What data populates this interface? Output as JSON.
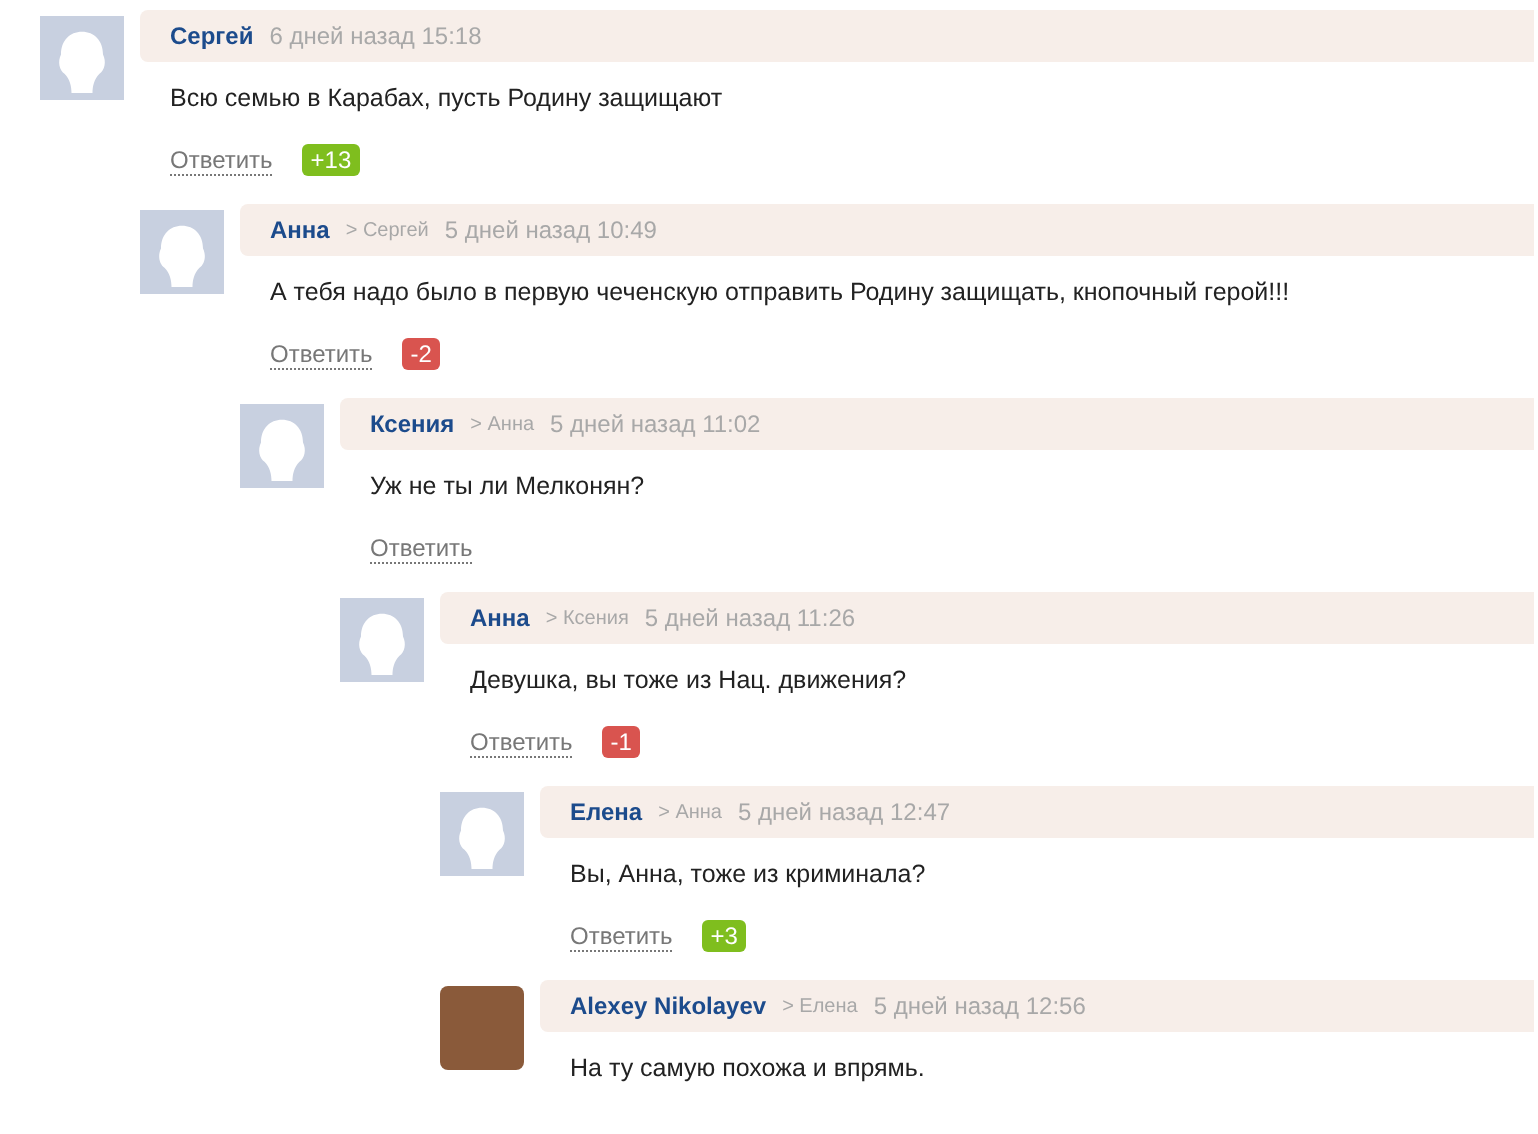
{
  "comments": [
    {
      "author": "Сергей",
      "kind": "silhouette",
      "time": "6 дней назад 15:18",
      "text": "Всю семью в Карабах, пусть Родину защищают",
      "reply": "Ответить",
      "score": {
        "text": "+13",
        "kind": "up"
      },
      "children": [
        {
          "author": "Анна",
          "reply_to": "> Сергей",
          "kind": "silhouette",
          "time": "5 дней назад 10:49",
          "text": "А тебя надо было в первую чеченскую отправить Родину защищать, кнопочный герой!!!",
          "reply": "Ответить",
          "score": {
            "text": "-2",
            "kind": "down"
          },
          "children": [
            {
              "author": "Ксения",
              "reply_to": "> Анна",
              "kind": "silhouette",
              "time": "5 дней назад 11:02",
              "text": "Уж не ты ли Мелконян?",
              "reply": "Ответить",
              "children": [
                {
                  "author": "Анна",
                  "reply_to": "> Ксения",
                  "kind": "silhouette",
                  "time": "5 дней назад 11:26",
                  "text": "Девушка, вы тоже из Нац. движения?",
                  "reply": "Ответить",
                  "score": {
                    "text": "-1",
                    "kind": "down"
                  },
                  "children": [
                    {
                      "author": "Елена",
                      "reply_to": "> Анна",
                      "kind": "silhouette",
                      "time": "5 дней назад 12:47",
                      "text": "Вы, Анна, тоже из криминала?",
                      "reply": "Ответить",
                      "score": {
                        "text": "+3",
                        "kind": "up"
                      }
                    },
                    {
                      "author": "Alexey Nikolayev",
                      "reply_to": "> Елена",
                      "kind": "photo",
                      "time": "5 дней назад 12:56",
                      "text": "На ту самую похожа и впрямь."
                    }
                  ]
                }
              ]
            }
          ]
        }
      ]
    }
  ]
}
